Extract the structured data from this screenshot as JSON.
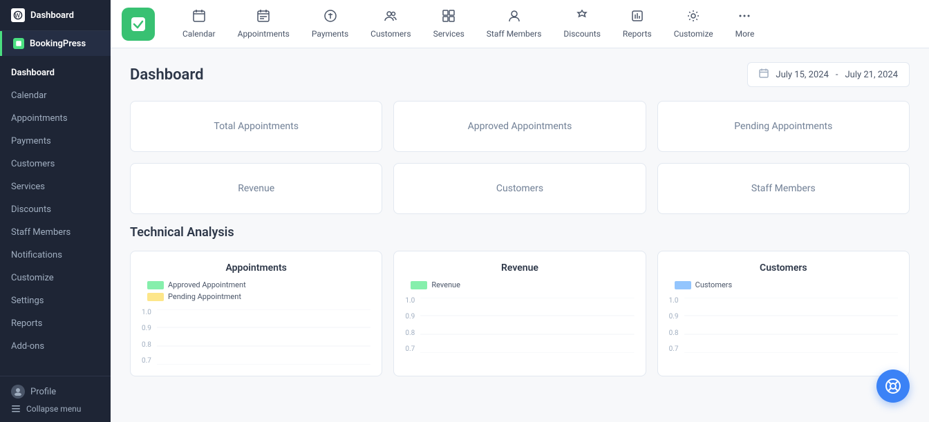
{
  "sidebar": {
    "app_title": "Dashboard",
    "plugin_name": "BookingPress",
    "nav_items": [
      {
        "id": "dashboard",
        "label": "Dashboard",
        "active": true
      },
      {
        "id": "calendar",
        "label": "Calendar"
      },
      {
        "id": "appointments",
        "label": "Appointments"
      },
      {
        "id": "payments",
        "label": "Payments"
      },
      {
        "id": "customers",
        "label": "Customers"
      },
      {
        "id": "services",
        "label": "Services"
      },
      {
        "id": "discounts",
        "label": "Discounts"
      },
      {
        "id": "staff-members",
        "label": "Staff Members"
      },
      {
        "id": "notifications",
        "label": "Notifications"
      },
      {
        "id": "customize",
        "label": "Customize"
      },
      {
        "id": "settings",
        "label": "Settings"
      },
      {
        "id": "reports",
        "label": "Reports"
      },
      {
        "id": "add-ons",
        "label": "Add-ons"
      }
    ],
    "profile_label": "Profile",
    "collapse_label": "Collapse menu"
  },
  "topnav": {
    "items": [
      {
        "id": "calendar",
        "label": "Calendar",
        "icon": "📅"
      },
      {
        "id": "appointments",
        "label": "Appointments",
        "icon": "📆"
      },
      {
        "id": "payments",
        "label": "Payments",
        "icon": "💰"
      },
      {
        "id": "customers",
        "label": "Customers",
        "icon": "👥"
      },
      {
        "id": "services",
        "label": "Services",
        "icon": "🗂"
      },
      {
        "id": "staff-members",
        "label": "Staff Members",
        "icon": "👤"
      },
      {
        "id": "discounts",
        "label": "Discounts",
        "icon": "🏷"
      },
      {
        "id": "reports",
        "label": "Reports",
        "icon": "📊"
      },
      {
        "id": "customize",
        "label": "Customize",
        "icon": "🎨"
      },
      {
        "id": "more",
        "label": "More",
        "icon": "⋯"
      }
    ]
  },
  "dashboard": {
    "title": "Dashboard",
    "date_start": "July 15, 2024",
    "date_separator": "-",
    "date_end": "July 21, 2024",
    "stat_cards": [
      {
        "id": "total-appointments",
        "label": "Total Appointments"
      },
      {
        "id": "approved-appointments",
        "label": "Approved Appointments"
      },
      {
        "id": "pending-appointments",
        "label": "Pending Appointments"
      },
      {
        "id": "revenue",
        "label": "Revenue"
      },
      {
        "id": "customers",
        "label": "Customers"
      },
      {
        "id": "staff-members",
        "label": "Staff Members"
      }
    ],
    "technical_analysis_title": "Technical Analysis",
    "charts": [
      {
        "id": "appointments-chart",
        "title": "Appointments",
        "legend": [
          {
            "label": "Approved Appointment",
            "color": "#86efac"
          },
          {
            "label": "Pending Appointment",
            "color": "#fde68a"
          }
        ],
        "y_labels": [
          "1.0",
          "0.9",
          "0.8",
          "0.7"
        ]
      },
      {
        "id": "revenue-chart",
        "title": "Revenue",
        "legend": [
          {
            "label": "Revenue",
            "color": "#86efac"
          }
        ],
        "y_labels": [
          "1.0",
          "0.9",
          "0.8",
          "0.7"
        ]
      },
      {
        "id": "customers-chart",
        "title": "Customers",
        "legend": [
          {
            "label": "Customers",
            "color": "#93c5fd"
          }
        ],
        "y_labels": [
          "1.0",
          "0.9",
          "0.8",
          "0.7"
        ]
      }
    ]
  }
}
